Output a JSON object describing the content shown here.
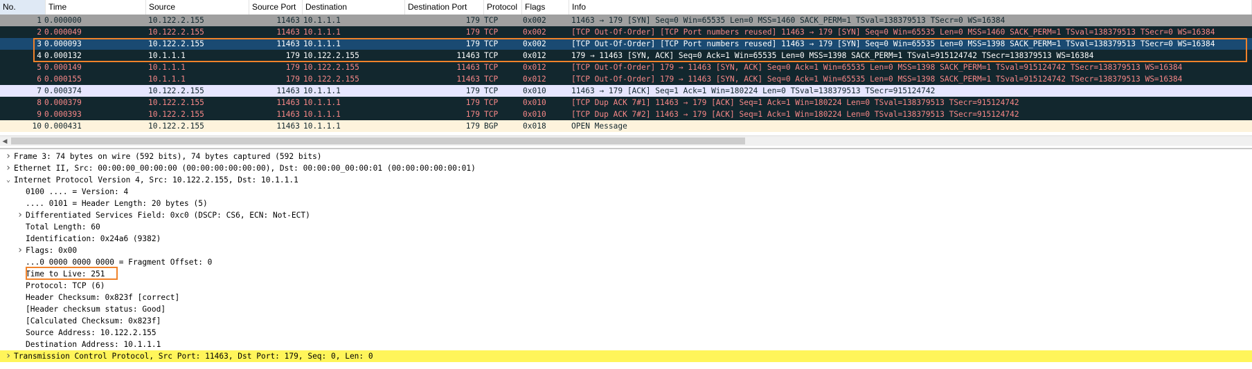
{
  "columns": [
    "No.",
    "Time",
    "Source",
    "Source Port",
    "Destination",
    "Destination Port",
    "Protocol",
    "Flags",
    "Info"
  ],
  "packets": [
    {
      "no": "1",
      "time": "0.000000",
      "src": "10.122.2.155",
      "sport": "11463",
      "dst": "10.1.1.1",
      "dport": "179",
      "proto": "TCP",
      "flags": "0x002",
      "info": "11463 → 179 [SYN] Seq=0 Win=65535 Len=0 MSS=1460 SACK_PERM=1 TSval=138379513 TSecr=0 WS=16384",
      "style": "gray"
    },
    {
      "no": "2",
      "time": "0.000049",
      "src": "10.122.2.155",
      "sport": "11463",
      "dst": "10.1.1.1",
      "dport": "179",
      "proto": "TCP",
      "flags": "0x002",
      "info": "[TCP Out-Of-Order] [TCP Port numbers reused] 11463 → 179 [SYN] Seq=0 Win=65535 Len=0 MSS=1460 SACK_PERM=1 TSval=138379513 TSecr=0 WS=16384",
      "style": "dark"
    },
    {
      "no": "3",
      "time": "0.000093",
      "src": "10.122.2.155",
      "sport": "11463",
      "dst": "10.1.1.1",
      "dport": "179",
      "proto": "TCP",
      "flags": "0x002",
      "info": "[TCP Out-Of-Order] [TCP Port numbers reused] 11463 → 179 [SYN] Seq=0 Win=65535 Len=0 MSS=1398 SACK_PERM=1 TSval=138379513 TSecr=0 WS=16384",
      "style": "sel"
    },
    {
      "no": "4",
      "time": "0.000132",
      "src": "10.1.1.1",
      "sport": "179",
      "dst": "10.122.2.155",
      "dport": "11463",
      "proto": "TCP",
      "flags": "0x012",
      "info": "179 → 11463 [SYN, ACK] Seq=0 Ack=1 Win=65535 Len=0 MSS=1398 SACK_PERM=1 TSval=915124742 TSecr=138379513 WS=16384",
      "style": "sel2"
    },
    {
      "no": "5",
      "time": "0.000149",
      "src": "10.1.1.1",
      "sport": "179",
      "dst": "10.122.2.155",
      "dport": "11463",
      "proto": "TCP",
      "flags": "0x012",
      "info": "[TCP Out-Of-Order] 179 → 11463 [SYN, ACK] Seq=0 Ack=1 Win=65535 Len=0 MSS=1398 SACK_PERM=1 TSval=915124742 TSecr=138379513 WS=16384",
      "style": "dark"
    },
    {
      "no": "6",
      "time": "0.000155",
      "src": "10.1.1.1",
      "sport": "179",
      "dst": "10.122.2.155",
      "dport": "11463",
      "proto": "TCP",
      "flags": "0x012",
      "info": "[TCP Out-Of-Order] 179 → 11463 [SYN, ACK] Seq=0 Ack=1 Win=65535 Len=0 MSS=1398 SACK_PERM=1 TSval=915124742 TSecr=138379513 WS=16384",
      "style": "dark"
    },
    {
      "no": "7",
      "time": "0.000374",
      "src": "10.122.2.155",
      "sport": "11463",
      "dst": "10.1.1.1",
      "dport": "179",
      "proto": "TCP",
      "flags": "0x010",
      "info": "11463 → 179 [ACK] Seq=1 Ack=1 Win=180224 Len=0 TSval=138379513 TSecr=915124742",
      "style": "lav"
    },
    {
      "no": "8",
      "time": "0.000379",
      "src": "10.122.2.155",
      "sport": "11463",
      "dst": "10.1.1.1",
      "dport": "179",
      "proto": "TCP",
      "flags": "0x010",
      "info": "[TCP Dup ACK 7#1] 11463 → 179 [ACK] Seq=1 Ack=1 Win=180224 Len=0 TSval=138379513 TSecr=915124742",
      "style": "dark"
    },
    {
      "no": "9",
      "time": "0.000393",
      "src": "10.122.2.155",
      "sport": "11463",
      "dst": "10.1.1.1",
      "dport": "179",
      "proto": "TCP",
      "flags": "0x010",
      "info": "[TCP Dup ACK 7#2] 11463 → 179 [ACK] Seq=1 Ack=1 Win=180224 Len=0 TSval=138379513 TSecr=915124742",
      "style": "dark"
    },
    {
      "no": "10",
      "time": "0.000431",
      "src": "10.122.2.155",
      "sport": "11463",
      "dst": "10.1.1.1",
      "dport": "179",
      "proto": "BGP",
      "flags": "0x018",
      "info": "OPEN Message",
      "style": "bgp"
    }
  ],
  "details": [
    {
      "twisty": "right",
      "indent": 0,
      "text": "Frame 3: 74 bytes on wire (592 bits), 74 bytes captured (592 bits)"
    },
    {
      "twisty": "right",
      "indent": 0,
      "text": "Ethernet II, Src: 00:00:00_00:00:00 (00:00:00:00:00:00), Dst: 00:00:00_00:00:01 (00:00:00:00:00:01)"
    },
    {
      "twisty": "down",
      "indent": 0,
      "text": "Internet Protocol Version 4, Src: 10.122.2.155, Dst: 10.1.1.1"
    },
    {
      "twisty": "",
      "indent": 1,
      "text": "0100 .... = Version: 4"
    },
    {
      "twisty": "",
      "indent": 1,
      "text": ".... 0101 = Header Length: 20 bytes (5)"
    },
    {
      "twisty": "right",
      "indent": 1,
      "text": "Differentiated Services Field: 0xc0 (DSCP: CS6, ECN: Not-ECT)"
    },
    {
      "twisty": "",
      "indent": 1,
      "text": "Total Length: 60"
    },
    {
      "twisty": "",
      "indent": 1,
      "text": "Identification: 0x24a6 (9382)"
    },
    {
      "twisty": "right",
      "indent": 1,
      "text": "Flags: 0x00"
    },
    {
      "twisty": "",
      "indent": 1,
      "text": "...0 0000 0000 0000 = Fragment Offset: 0"
    },
    {
      "twisty": "",
      "indent": 1,
      "text": "Time to Live: 251"
    },
    {
      "twisty": "",
      "indent": 1,
      "text": "Protocol: TCP (6)"
    },
    {
      "twisty": "",
      "indent": 1,
      "text": "Header Checksum: 0x823f [correct]"
    },
    {
      "twisty": "",
      "indent": 1,
      "text": "[Header checksum status: Good]"
    },
    {
      "twisty": "",
      "indent": 1,
      "text": "[Calculated Checksum: 0x823f]"
    },
    {
      "twisty": "",
      "indent": 1,
      "text": "Source Address: 10.122.2.155"
    },
    {
      "twisty": "",
      "indent": 1,
      "text": "Destination Address: 10.1.1.1"
    },
    {
      "twisty": "right",
      "indent": 0,
      "text": "Transmission Control Protocol, Src Port: 11463, Dst Port: 179, Seq: 0, Len: 0",
      "style": "tcp"
    }
  ],
  "icons": {
    "collapsed": "chevron-right-icon",
    "expanded": "chevron-down-icon",
    "scroll_left": "arrow-left-icon"
  },
  "colors": {
    "highlight_box": "#f0822a",
    "selected_row": "#1a4a72",
    "dark_row": "#12272e",
    "tcp_highlight": "#fff55a"
  }
}
